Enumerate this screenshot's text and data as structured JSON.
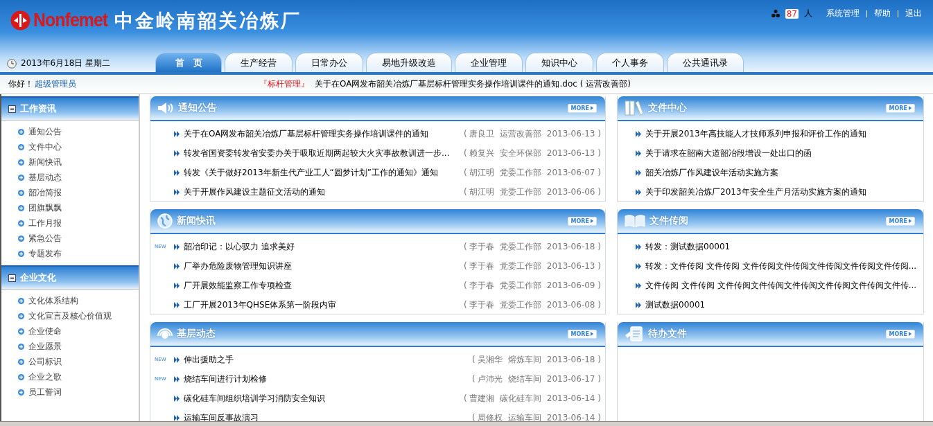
{
  "header": {
    "logo": "Nonfemet",
    "title": "中金岭南韶关冶炼厂",
    "online_count": "87",
    "online_unit": "人",
    "links": [
      "系统管理",
      "帮助",
      "退出"
    ],
    "date": "2013年6月18日  星期二"
  },
  "tabs": [
    {
      "label": "首　页",
      "selected": true
    },
    {
      "label": "生产经营",
      "selected": false
    },
    {
      "label": "日常办公",
      "selected": false
    },
    {
      "label": "易地升级改造",
      "selected": false
    },
    {
      "label": "企业管理",
      "selected": false
    },
    {
      "label": "知识中心",
      "selected": false
    },
    {
      "label": "个人事务",
      "selected": false
    },
    {
      "label": "公共通讯录",
      "selected": false
    }
  ],
  "greeting": {
    "hello": "你好！",
    "user": "超级管理员",
    "notice_tag": "『标杆管理』",
    "notice": "关于在OA网发布韶关冶炼厂基层标杆管理实务操作培训课件的通知.doc ( 运营改善部)"
  },
  "sidebar": [
    {
      "title": "工作资讯",
      "expanded": true,
      "items": [
        "通知公告",
        "文件中心",
        "新闻快讯",
        "基层动态",
        "韶冶简报",
        "团旗飘飘",
        "工作月报",
        "紧急公告",
        "专题发布"
      ]
    },
    {
      "title": "企业文化",
      "expanded": true,
      "items": [
        "文化体系结构",
        "文化宣言及核心价值观",
        "企业使命",
        "企业愿景",
        "公司标识",
        "企业之歌",
        "员工誓词"
      ]
    }
  ],
  "panels": [
    {
      "title": "通知公告",
      "more": "MORE",
      "items": [
        {
          "text": "关于在OA网发布韶关冶炼厂基层标杆管理实务操作培训课件的通知",
          "meta": "( 唐良卫  运营改善部  2013-06-13 )"
        },
        {
          "text": "转发省国资委转发省安委办关于吸取近期两起较大火灾事故教训进一步...",
          "meta": "( 赖复兴  安全环保部  2013-06-13 )"
        },
        {
          "text": "转发《关于做好2013年新生代产业工人“圆梦计划”工作的通知》通知",
          "meta": "( 胡江明  党委工作部  2013-06-07 )"
        },
        {
          "text": "关于开展作风建设主题征文活动的通知",
          "meta": "( 胡江明  党委工作部  2013-06-06 )"
        }
      ]
    },
    {
      "title": "文件中心",
      "more": "MORE",
      "items": [
        {
          "text": "关于开展2013年高技能人才技师系列申报和评价工作的通知"
        },
        {
          "text": "关于请求在韶南大道韶冶段增设一处出口的函"
        },
        {
          "text": "韶关冶炼厂作风建设年活动实施方案"
        },
        {
          "text": "关于印发韶关冶炼厂2013年安全生产月活动实施方案的通知"
        }
      ]
    },
    {
      "title": "新闻快讯",
      "more": "MORE",
      "items": [
        {
          "badge": "NEW",
          "text": "韶冶印记：以心驭力 追求美好",
          "meta": "( 李于春  党委工作部  2013-06-18 )"
        },
        {
          "text": "厂举办危险废物管理知识讲座",
          "meta": "( 李于春  党委工作部  2013-06-13 )"
        },
        {
          "text": "厂开展效能监察工作专项检查",
          "meta": "( 李于春  党委工作部  2013-06-09 )"
        },
        {
          "text": "工厂开展2013年QHSE体系第一阶段内审",
          "meta": "( 李于春  党委工作部  2013-06-08 )"
        }
      ]
    },
    {
      "title": "文件传阅",
      "more": "MORE",
      "items": [
        {
          "text": "转发：测试数据00001"
        },
        {
          "text": "转发：文件传阅 文件传阅 文件传阅文件传阅文件传阅文件传阅文件传阅..."
        },
        {
          "text": "文件传阅 文件传阅 文件传阅文件传阅文件传阅文件传阅文件传阅文件传..."
        },
        {
          "text": "测试数据00001"
        }
      ]
    },
    {
      "title": "基层动态",
      "more": "MORE",
      "items": [
        {
          "badge": "NEW",
          "text": "伸出援助之手",
          "meta": "( 吴湘华  熔炼车间  2013-06-18 )"
        },
        {
          "badge": "NEW",
          "text": "烧结车间进行计划检修",
          "meta": "( 卢沛光  烧结车间  2013-06-17 )"
        },
        {
          "text": "碳化硅车间组织培训学习消防安全知识",
          "meta": "( 曹建湘  碳化硅车间  2013-06-14 )"
        },
        {
          "text": "运输车间反事故演习",
          "meta": "( 周修权  运输车间  2013-06-14 )"
        }
      ]
    },
    {
      "title": "待办文件",
      "more": "MORE"
    }
  ]
}
